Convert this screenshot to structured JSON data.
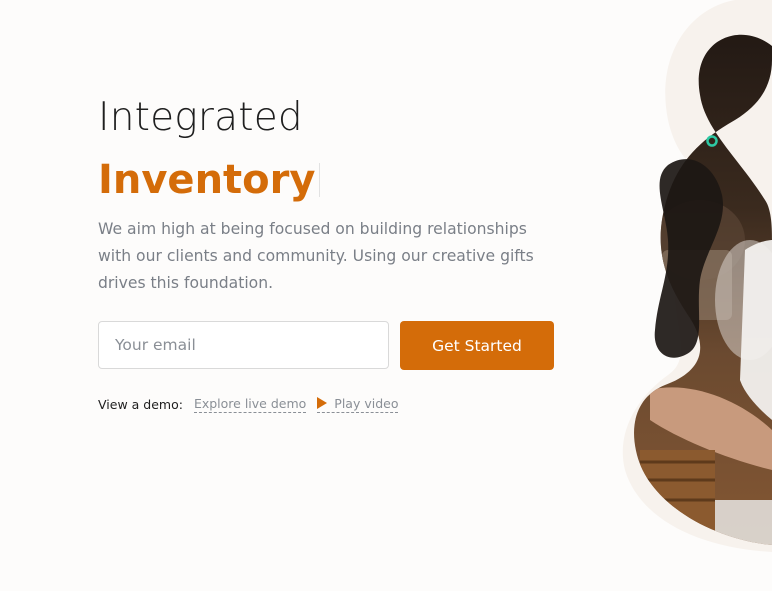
{
  "hero": {
    "headline_line1": "Integrated",
    "headline_line2": "Inventory",
    "description": "We aim high at being focused on building relationships with our clients and community. Using our creative gifts drives this foundation."
  },
  "signup": {
    "email_placeholder": "Your email",
    "cta_label": "Get Started"
  },
  "demo": {
    "label": "View a demo:",
    "explore_label": "Explore live demo",
    "play_label": "Play video"
  },
  "icons": {
    "play": "play-icon",
    "accent_dot": "ring-dot-icon"
  },
  "colors": {
    "accent": "#d46c09",
    "heading": "#1f1f1f",
    "body_text": "#7a7f87",
    "background": "#fdfcfb",
    "blob": "#f7f2ed",
    "dot": "#2ec9a4"
  }
}
